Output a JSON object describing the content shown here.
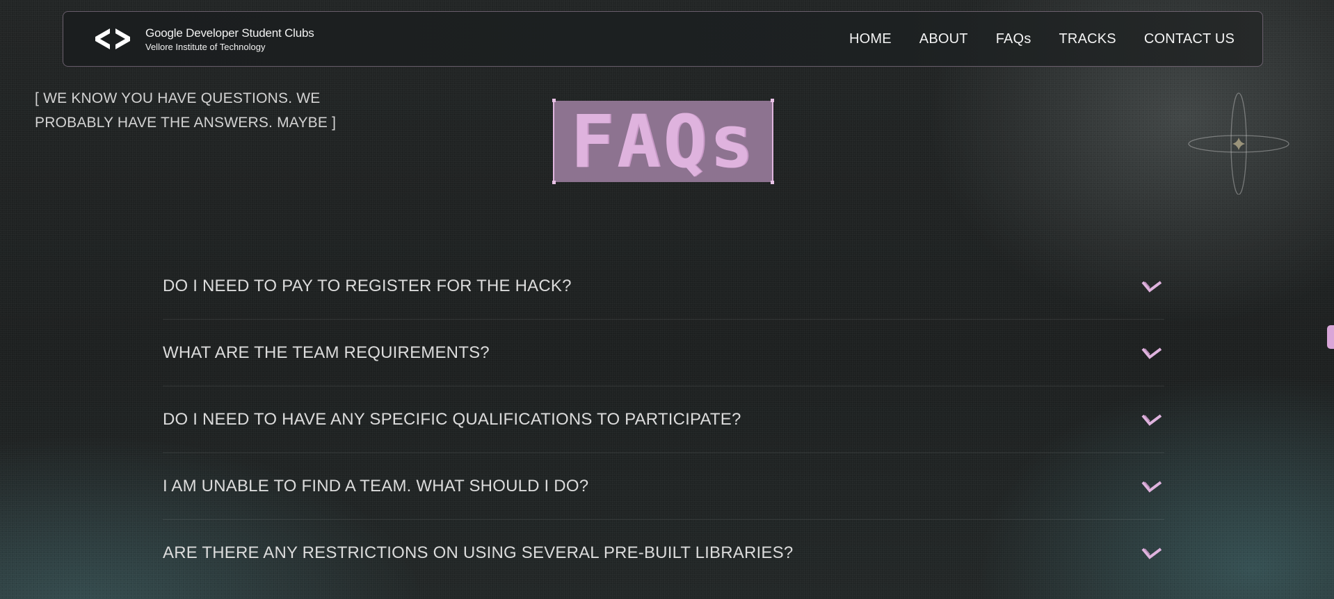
{
  "header": {
    "brand_title": "Google Developer Student Clubs",
    "brand_subtitle": "Vellore Institute of Technology",
    "logo_icon": "gdsc-brackets-icon",
    "nav": [
      {
        "label": "HOME"
      },
      {
        "label": "ABOUT"
      },
      {
        "label": "FAQs"
      },
      {
        "label": "TRACKS"
      },
      {
        "label": "CONTACT US"
      }
    ]
  },
  "hero": {
    "tagline": "[ WE KNOW YOU HAVE QUESTIONS. WE PROBABLY HAVE THE ANSWERS. MAYBE ]",
    "title": "FAQs",
    "decor_icon": "orbit-star-icon"
  },
  "faqs": [
    {
      "question": "DO I NEED TO PAY TO REGISTER FOR THE HACK?"
    },
    {
      "question": "WHAT ARE THE TEAM REQUIREMENTS?"
    },
    {
      "question": "DO I NEED TO HAVE ANY SPECIFIC QUALIFICATIONS TO PARTICIPATE?"
    },
    {
      "question": "I AM UNABLE TO FIND A TEAM. WHAT SHOULD I DO?"
    },
    {
      "question": "ARE THERE ANY RESTRICTIONS ON USING SEVERAL PRE-BUILT LIBRARIES?"
    }
  ],
  "colors": {
    "accent": "#dfb3de",
    "title_bg": "#8d7390",
    "background": "#1f2222",
    "text": "#dcdcdc"
  }
}
